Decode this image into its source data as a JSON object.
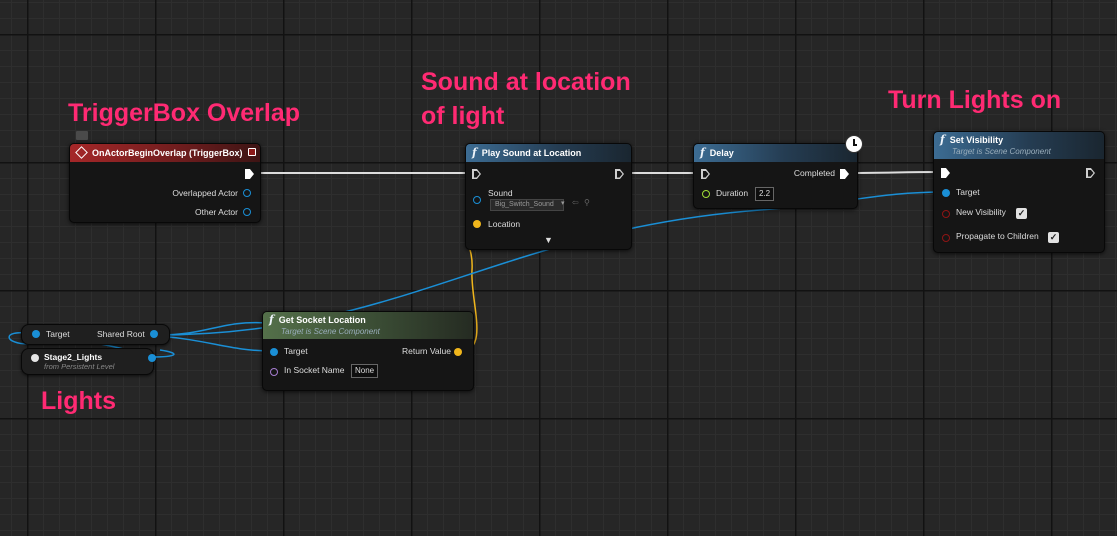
{
  "annotations": {
    "trigger": "TriggerBox Overlap",
    "sound_line1": "Sound at location",
    "sound_line2": "of light",
    "turn_lights": "Turn Lights on",
    "lights": "Lights"
  },
  "nodes": {
    "event": {
      "title": "OnActorBeginOverlap (TriggerBox)",
      "overlapped_actor": "Overlapped Actor",
      "other_actor": "Other Actor"
    },
    "play_sound": {
      "title": "Play Sound at Location",
      "sound_label": "Sound",
      "sound_value": "Big_Switch_Sound",
      "location_label": "Location"
    },
    "delay": {
      "title": "Delay",
      "completed_label": "Completed",
      "duration_label": "Duration",
      "duration_value": "2.2"
    },
    "set_visibility": {
      "title": "Set Visibility",
      "subtitle": "Target is Scene Component",
      "target_label": "Target",
      "new_visibility_label": "New Visibility",
      "propagate_label": "Propagate to Children"
    },
    "get_socket_location": {
      "title": "Get Socket Location",
      "subtitle": "Target is Scene Component",
      "target_label": "Target",
      "return_value_label": "Return Value",
      "socket_name_label": "In Socket Name",
      "socket_name_value": "None"
    },
    "shared_root": {
      "target_label": "Target",
      "output_label": "Shared Root"
    },
    "stage2_lights": {
      "title": "Stage2_Lights",
      "subtitle": "from Persistent Level"
    }
  },
  "colors": {
    "object_wire": "#1a8fd6",
    "vector_wire": "#f0b61c",
    "exec_wire": "#ffffff",
    "annotation": "#ff2a73"
  }
}
